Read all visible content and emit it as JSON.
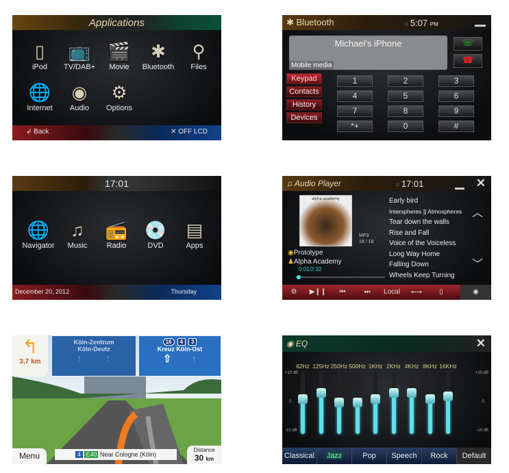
{
  "applications": {
    "title": "Applications",
    "icons": [
      {
        "label": "iPod",
        "icon": "ipod-icon",
        "glyph": "▯"
      },
      {
        "label": "TV/DAB+",
        "icon": "tv-icon",
        "glyph": "📺"
      },
      {
        "label": "Movie",
        "icon": "clapperboard-icon",
        "glyph": "🎬"
      },
      {
        "label": "Bluetooth",
        "icon": "bluetooth-icon",
        "glyph": "✱"
      },
      {
        "label": "Files",
        "icon": "files-icon",
        "glyph": "⚲"
      },
      {
        "label": "Internet",
        "icon": "globe-icon",
        "glyph": "🌐"
      },
      {
        "label": "Audio",
        "icon": "speaker-icon",
        "glyph": "◉"
      },
      {
        "label": "Options",
        "icon": "gear-icon",
        "glyph": "⚙"
      }
    ],
    "back": "Back",
    "off_lcd": "OFF LCD"
  },
  "bluetooth": {
    "title": "Bluetooth",
    "time": "5:07",
    "ampm": "PM",
    "device": "Michael's iPhone",
    "mobile_media": "Mobile media",
    "side": [
      "Keypad",
      "Contacts",
      "History",
      "Devices"
    ],
    "keys": [
      "1",
      "2",
      "3",
      "4",
      "5",
      "6",
      "7",
      "8",
      "9",
      "*+",
      "0",
      "#"
    ]
  },
  "home": {
    "time": "17:01",
    "icons": [
      {
        "label": "Navigator",
        "icon": "globe-icon",
        "glyph": "🌐"
      },
      {
        "label": "Music",
        "icon": "music-note-icon",
        "glyph": "♫"
      },
      {
        "label": "Radio",
        "icon": "radio-icon",
        "glyph": "📻"
      },
      {
        "label": "DVD",
        "icon": "disc-icon",
        "glyph": "💿"
      },
      {
        "label": "Apps",
        "icon": "apps-icon",
        "glyph": "▤"
      }
    ],
    "date": "December 20, 2012",
    "day": "Thursday"
  },
  "audio": {
    "title": "Audio Player",
    "time": "17:01",
    "album_text": "alpha academy",
    "format": "MP3",
    "track_index": "18 / 18",
    "album": "Prototype",
    "artist": "Alpha Academy",
    "elapsed": "0:01/2:32",
    "progress": 0.01,
    "tracks": [
      "Early bird",
      "Interspheres ][ Atmospheres",
      "Tear down the walls",
      "Rise and Fall",
      "Voice of the Voiceless",
      "Long Way Home",
      "Falling Down",
      "Wheels Keep Turning"
    ],
    "controls": {
      "local": "Local"
    }
  },
  "nav": {
    "turn_distance": "3,7 km",
    "sign_left": [
      "Köln-Zentrum",
      "Köln-Deutz"
    ],
    "sign_right_badges": [
      "16",
      "4",
      "3"
    ],
    "sign_right": "Kreuz Köln-Ost",
    "menu": "Menu",
    "road_badge1": "4",
    "road_badge2": "E40",
    "location": "Near Cologne (Köln)",
    "distance_label": "Distance",
    "distance_value": "30",
    "distance_unit": "km"
  },
  "eq": {
    "title": "EQ",
    "bands": [
      "62Hz",
      "125Hz",
      "250Hz",
      "500Hz",
      "1KHz",
      "2KHz",
      "4KHz",
      "8KHz",
      "16KHz"
    ],
    "levels_db": [
      1,
      3,
      0,
      0,
      1,
      3,
      3,
      1,
      2
    ],
    "range_db": [
      -10,
      10
    ],
    "scale": {
      "top": "+10 dB",
      "mid": "0",
      "bottom": "-10 dB"
    },
    "presets": [
      "Classical",
      "Jazz",
      "Pop",
      "Speech",
      "Rock"
    ],
    "selected_preset": "Jazz",
    "default": "Default",
    "accent": "#5fe0e8"
  }
}
